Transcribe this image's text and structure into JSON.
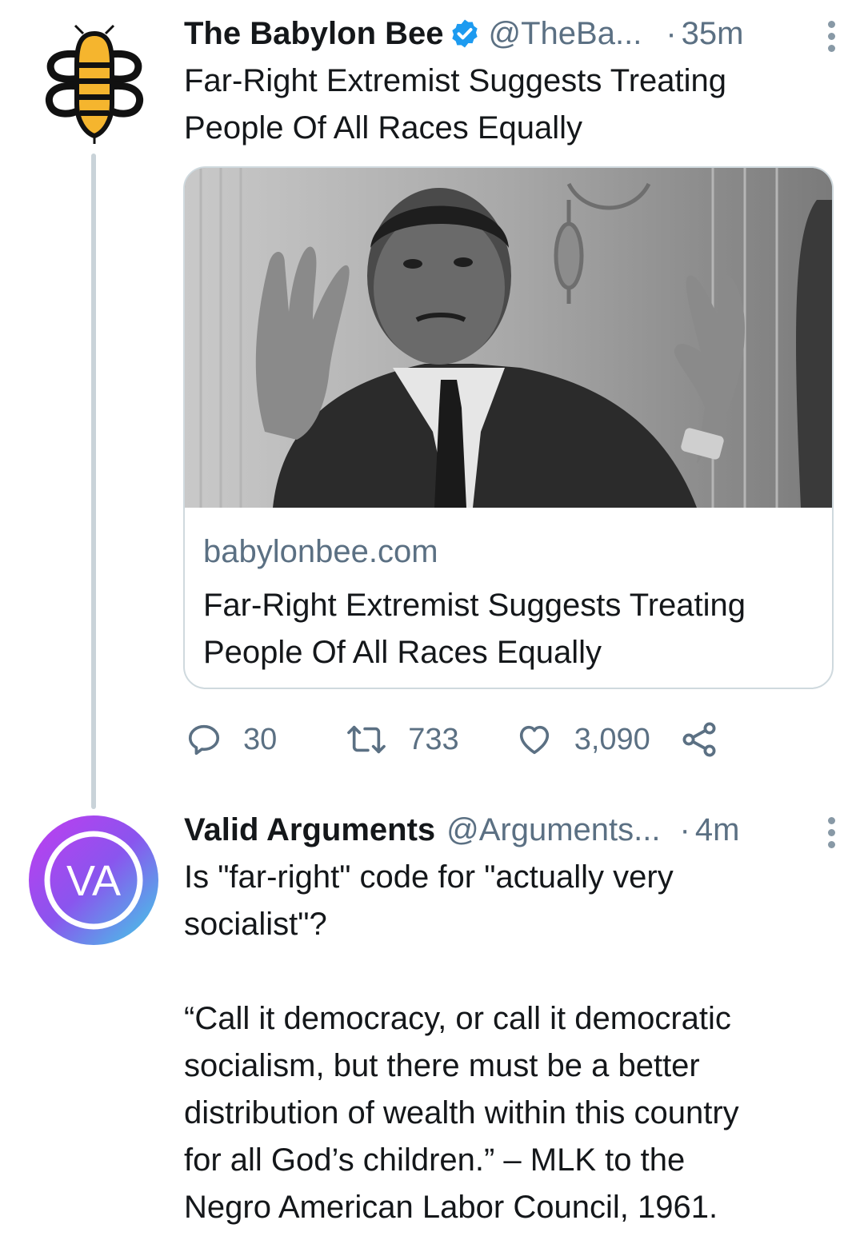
{
  "tweets": [
    {
      "display_name": "The Babylon Bee",
      "handle": "@TheBa...",
      "separator": "·",
      "time": "35m",
      "text_lines": [
        "Far-Right Extremist Suggests Treating",
        "People Of All Races Equally"
      ],
      "verified": true,
      "card": {
        "domain": "babylonbee.com",
        "title_lines": [
          "Far-Right Extremist Suggests Treating",
          "People Of All Races Equally"
        ]
      },
      "actions": {
        "replies": "30",
        "retweets": "733",
        "likes": "3,090"
      }
    },
    {
      "display_name": "Valid Arguments",
      "handle": "@Arguments...",
      "separator": "·",
      "time": "4m",
      "avatar_text": "VA",
      "text_lines": [
        "Is \"far-right\" code for \"actually very",
        "socialist\"?",
        "",
        "“Call it democracy, or call it democratic",
        "socialism, but there must be a better",
        "distribution of wealth within this country",
        "for all God’s children.” – MLK to the",
        "Negro American Labor Council, 1961."
      ]
    }
  ],
  "icons": {
    "reply": "reply-icon",
    "retweet": "retweet-icon",
    "like": "heart-icon",
    "share": "share-icon",
    "more": "more-vertical-icon",
    "verified": "verified-badge-icon"
  },
  "colors": {
    "verified": "#1d9bf0",
    "secondary_text": "#5b7083",
    "bee_yellow": "#f5b52e",
    "va_gradient_start": "#c13cf0",
    "va_gradient_end": "#3fd0e6"
  }
}
